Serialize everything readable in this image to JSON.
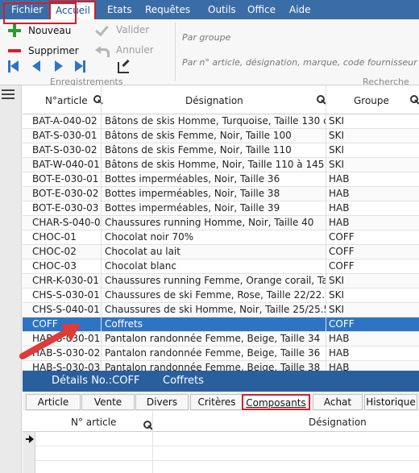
{
  "menu": {
    "items": [
      "Fichier",
      "Accueil",
      "Etats",
      "Requêtes",
      "Outils",
      "Office",
      "Aide"
    ]
  },
  "ribbon": {
    "nouveau": "Nouveau",
    "supprimer": "Supprimer",
    "valider": "Valider",
    "annuler": "Annuler",
    "group_enregistrements": "Enregistrements",
    "group_recherche": "Recherche",
    "search_group_placeholder": "Par groupe",
    "search_article_placeholder": "Par n° article, désignation,  marque, code fournisseur"
  },
  "grid": {
    "columns": [
      "N°article",
      "Désignation",
      "Groupe"
    ],
    "rows": [
      [
        "BAT-A-040-02",
        "Bâtons de skis Homme, Turquoise, Taille 130 cm",
        "SKI"
      ],
      [
        "BAT-S-030-01",
        "Bâtons de skis Femme, Noir, Taille 100",
        "SKI"
      ],
      [
        "BAT-S-030-02",
        "Bâtons de skis Femme, Noir, Taille 110",
        "SKI"
      ],
      [
        "BAT-W-040-01",
        "Bâtons de skis Homme, Noir, Taille 110 à 145 cm",
        "SKI"
      ],
      [
        "BOT-E-030-01",
        "Bottes imperméables, Noir, Taille 36",
        "HAB"
      ],
      [
        "BOT-E-030-02",
        "Bottes imperméables, Noir, Taille 38",
        "HAB"
      ],
      [
        "BOT-E-030-03",
        "Bottes imperméables, Noir, Taille 39",
        "HAB"
      ],
      [
        "CHAR-S-040-0",
        "Chaussures running Homme, Noir, Taille 40",
        "HAB"
      ],
      [
        "CHOC-01",
        "Chocolat noir 70%",
        "COFF"
      ],
      [
        "CHOC-02",
        "Chocolat au lait",
        "COFF"
      ],
      [
        "CHOC-03",
        "Chocolat blanc",
        "COFF"
      ],
      [
        "CHR-K-030-01",
        "Chaussures running Femme, Orange corail, Taille 36",
        "SKI"
      ],
      [
        "CHS-S-030-01",
        "Chaussures de ski Femme, Rose, Taille 22/22.5",
        "SKI"
      ],
      [
        "CHS-S-040-01",
        "Chaussures de ski Homme, Noir, Taille 25/25.5",
        "SKI"
      ],
      [
        "COFF",
        "Coffrets",
        "COFF"
      ],
      [
        "HAB-S-030-01",
        "Pantalon randonnée Femme, Beige, Taille 34",
        "HAB"
      ],
      [
        "HAB-S-030-02",
        "Pantalon randonnée Femme, Beige, Taille 36",
        "HAB"
      ],
      [
        "HAB-S-030-03",
        "Pantalon randonnée Femme, Beige, Taille 38",
        "HAB"
      ]
    ],
    "selected_index": 14
  },
  "details": {
    "label": "Détails No.:COFF",
    "name": "Coffrets"
  },
  "tabs": [
    "Article",
    "Vente",
    "Divers",
    "Critères",
    "Composants",
    "Achat",
    "Historique"
  ],
  "active_tab": "Composants",
  "subgrid": {
    "columns": [
      "N° article",
      "Désignation"
    ]
  },
  "colors": {
    "menu_bg": "#3a6da8",
    "selection": "#2f74c3",
    "details_bg": "#2a5f9e",
    "annotation_red": "#d0202a"
  }
}
